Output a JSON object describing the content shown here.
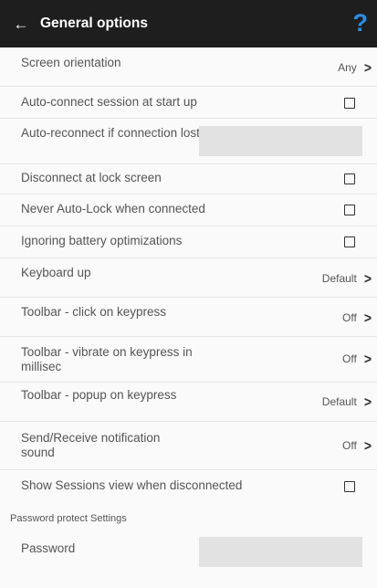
{
  "appbar": {
    "title": "General options",
    "back_icon": "arrow-left-icon",
    "help_label": "?",
    "help_color": "#2d8ce6"
  },
  "settings": {
    "screen_orientation": {
      "label": "Screen orientation",
      "value": "Any"
    },
    "auto_connect": {
      "label": "Auto-connect session at start up",
      "checked": false
    },
    "auto_reconnect": {
      "label": "Auto-reconnect if connection lost",
      "value": ""
    },
    "disconnect_lock": {
      "label": "Disconnect at lock screen",
      "checked": false
    },
    "never_autolock": {
      "label": "Never Auto-Lock when connected",
      "checked": false
    },
    "ignore_battery": {
      "label": "Ignoring battery optimizations",
      "checked": false
    },
    "keyboard_up": {
      "label": "Keyboard up",
      "value": "Default"
    },
    "toolbar_click": {
      "label": "Toolbar - click on keypress",
      "value": "Off"
    },
    "toolbar_vibrate": {
      "label": "Toolbar - vibrate on keypress in millisec",
      "value": "Off"
    },
    "toolbar_popup": {
      "label": "Toolbar - popup on keypress",
      "value": "Default"
    },
    "notification_sound": {
      "label": "Send/Receive notification sound",
      "value": "Off"
    },
    "show_sessions": {
      "label": "Show Sessions view when disconnected",
      "checked": false
    }
  },
  "password_section": {
    "header": "Password protect Settings",
    "password": {
      "label": "Password",
      "value": ""
    }
  },
  "chevron": ">"
}
